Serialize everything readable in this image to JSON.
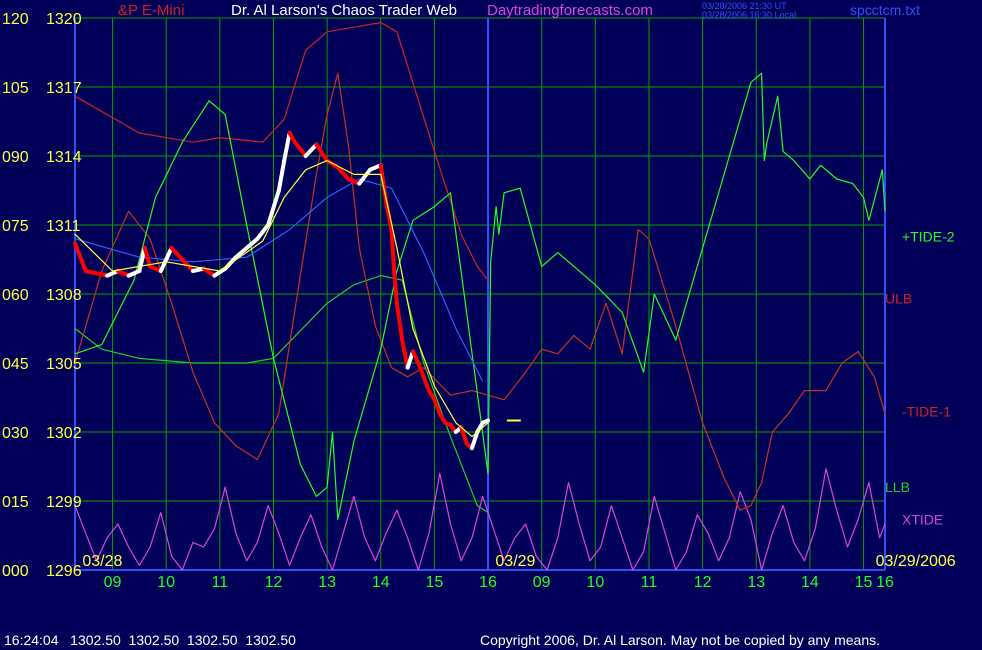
{
  "header": {
    "symbol": "&P E-Mini",
    "title": "Dr. Al Larson's Chaos Trader Web",
    "site": "Daytradingforecasts.com",
    "utc_line": "03/28/2006 21:30 UT",
    "local_line": "03/28/2006 16:30 Local",
    "file": "spcctcm.txt"
  },
  "footer": {
    "quote": "16:24:04   1302.50  1302.50  1302.50  1302.50",
    "copyright": "Copyright 2006, Dr. Al Larson. May not be copied by any means."
  },
  "colors": {
    "background": "#000058",
    "grid": "#00a000",
    "axis": "#3050ff",
    "price_up": "#ffffff",
    "price_down": "#ff0000",
    "tide2": "#20ff20",
    "ulb": "#d02020",
    "llb": "#20d020",
    "tide1": "#c83020",
    "xtide": "#e040e0",
    "ma_fast": "#ffff40",
    "ma_slow": "#3060ff"
  },
  "chart_data": {
    "type": "line",
    "left_axis_labels": [
      "120",
      "105",
      "090",
      "075",
      "060",
      "045",
      "030",
      "015",
      "000"
    ],
    "price_axis_labels": [
      "1320",
      "1317",
      "1314",
      "1311",
      "1308",
      "1305",
      "1302",
      "1299",
      "1296"
    ],
    "price_range": [
      1296,
      1320
    ],
    "oscillator_range": [
      0,
      120
    ],
    "x_ticks": [
      "09",
      "10",
      "11",
      "12",
      "13",
      "14",
      "15",
      "16",
      "09",
      "10",
      "11",
      "12",
      "13",
      "14",
      "15",
      "16"
    ],
    "hours_range": [
      8.3,
      23.4
    ],
    "date_labels": [
      {
        "text": "03/28",
        "hour": 8.4
      },
      {
        "text": "03/29",
        "hour": 16.1
      },
      {
        "text": "03/29/2006",
        "hour": 23.3
      }
    ],
    "last_price": 1302.5,
    "series_labels": [
      {
        "name": "+TIDE-2",
        "key": "tide2"
      },
      {
        "name": "ULB",
        "key": "ulb"
      },
      {
        "name": "-TIDE-1",
        "key": "tide1"
      },
      {
        "name": "LLB",
        "key": "llb"
      },
      {
        "name": "XTIDE",
        "key": "xtide"
      }
    ],
    "price_series": [
      [
        8.3,
        1310.2
      ],
      [
        8.5,
        1309.0
      ],
      [
        8.7,
        1308.9
      ],
      [
        8.9,
        1308.8
      ],
      [
        9.1,
        1309.0
      ],
      [
        9.3,
        1308.8
      ],
      [
        9.5,
        1309.0
      ],
      [
        9.6,
        1310.0
      ],
      [
        9.7,
        1309.2
      ],
      [
        9.9,
        1309.0
      ],
      [
        10.1,
        1310.0
      ],
      [
        10.3,
        1309.5
      ],
      [
        10.5,
        1309.0
      ],
      [
        10.7,
        1309.1
      ],
      [
        10.9,
        1308.8
      ],
      [
        11.1,
        1309.1
      ],
      [
        11.3,
        1309.6
      ],
      [
        11.5,
        1310.0
      ],
      [
        11.7,
        1310.4
      ],
      [
        11.9,
        1311.0
      ],
      [
        12.1,
        1312.5
      ],
      [
        12.2,
        1313.8
      ],
      [
        12.3,
        1315.0
      ],
      [
        12.4,
        1314.6
      ],
      [
        12.6,
        1314.0
      ],
      [
        12.8,
        1314.5
      ],
      [
        13.0,
        1313.8
      ],
      [
        13.2,
        1313.5
      ],
      [
        13.4,
        1313.0
      ],
      [
        13.6,
        1312.8
      ],
      [
        13.8,
        1313.4
      ],
      [
        14.0,
        1313.6
      ],
      [
        14.1,
        1312.0
      ],
      [
        14.2,
        1310.8
      ],
      [
        14.25,
        1309.0
      ],
      [
        14.3,
        1307.6
      ],
      [
        14.4,
        1306.0
      ],
      [
        14.5,
        1304.8
      ],
      [
        14.6,
        1305.5
      ],
      [
        14.7,
        1305.0
      ],
      [
        14.8,
        1304.4
      ],
      [
        14.9,
        1303.8
      ],
      [
        15.0,
        1303.4
      ],
      [
        15.1,
        1302.8
      ],
      [
        15.2,
        1302.4
      ],
      [
        15.3,
        1302.3
      ],
      [
        15.4,
        1302.0
      ],
      [
        15.5,
        1302.2
      ],
      [
        15.6,
        1301.5
      ],
      [
        15.7,
        1301.3
      ],
      [
        15.8,
        1302.0
      ],
      [
        15.9,
        1302.4
      ],
      [
        16.0,
        1302.5
      ]
    ],
    "ma_fast": [
      [
        8.3,
        1310.6
      ],
      [
        9.0,
        1309.0
      ],
      [
        10.0,
        1309.4
      ],
      [
        11.0,
        1309.0
      ],
      [
        11.8,
        1310.3
      ],
      [
        12.2,
        1312.2
      ],
      [
        12.6,
        1313.4
      ],
      [
        13.0,
        1313.8
      ],
      [
        13.5,
        1313.2
      ],
      [
        14.0,
        1313.2
      ],
      [
        14.3,
        1310.0
      ],
      [
        14.6,
        1306.5
      ],
      [
        15.0,
        1304.0
      ],
      [
        15.4,
        1302.4
      ],
      [
        15.7,
        1301.8
      ],
      [
        16.0,
        1302.4
      ]
    ],
    "ma_slow": [
      [
        8.3,
        1310.4
      ],
      [
        9.5,
        1309.6
      ],
      [
        10.5,
        1309.4
      ],
      [
        11.5,
        1309.6
      ],
      [
        12.3,
        1310.8
      ],
      [
        13.0,
        1312.2
      ],
      [
        13.6,
        1313.0
      ],
      [
        14.2,
        1312.6
      ],
      [
        14.8,
        1309.8
      ],
      [
        15.4,
        1306.5
      ],
      [
        15.9,
        1304.2
      ]
    ],
    "ulb": [
      [
        8.3,
        1316.6
      ],
      [
        9.5,
        1315.0
      ],
      [
        10.5,
        1314.6
      ],
      [
        11.0,
        1314.8
      ],
      [
        11.8,
        1314.6
      ],
      [
        12.2,
        1315.6
      ],
      [
        12.6,
        1318.6
      ],
      [
        13.0,
        1319.4
      ],
      [
        13.5,
        1319.6
      ],
      [
        14.0,
        1319.8
      ],
      [
        14.3,
        1319.4
      ],
      [
        15.0,
        1314.2
      ],
      [
        15.5,
        1310.6
      ],
      [
        15.8,
        1309.2
      ],
      [
        16.0,
        1308.6
      ]
    ],
    "llb": [
      [
        8.3,
        1306.5
      ],
      [
        8.8,
        1305.6
      ],
      [
        9.5,
        1305.2
      ],
      [
        10.5,
        1305.0
      ],
      [
        11.5,
        1305.0
      ],
      [
        12.0,
        1305.2
      ],
      [
        12.5,
        1306.4
      ],
      [
        13.0,
        1307.6
      ],
      [
        13.5,
        1308.4
      ],
      [
        14.0,
        1308.8
      ],
      [
        14.4,
        1308.6
      ],
      [
        14.8,
        1305.0
      ],
      [
        15.3,
        1301.8
      ],
      [
        15.8,
        1298.8
      ],
      [
        16.0,
        1298.5
      ]
    ],
    "tide2": [
      [
        8.3,
        1305.4
      ],
      [
        8.8,
        1305.8
      ],
      [
        9.4,
        1308.6
      ],
      [
        9.8,
        1312.2
      ],
      [
        10.3,
        1314.6
      ],
      [
        10.8,
        1316.4
      ],
      [
        11.1,
        1315.8
      ],
      [
        11.5,
        1311.0
      ],
      [
        12.0,
        1305.2
      ],
      [
        12.5,
        1300.6
      ],
      [
        12.8,
        1299.2
      ],
      [
        13.0,
        1299.6
      ],
      [
        13.1,
        1302.0
      ],
      [
        13.2,
        1298.2
      ],
      [
        13.5,
        1301.6
      ],
      [
        14.0,
        1305.6
      ],
      [
        14.3,
        1309.0
      ],
      [
        14.6,
        1311.2
      ],
      [
        15.0,
        1311.8
      ],
      [
        15.3,
        1312.4
      ],
      [
        15.6,
        1307.2
      ],
      [
        16.0,
        1300.2
      ],
      [
        16.05,
        1309.4
      ],
      [
        16.1,
        1310.6
      ],
      [
        16.15,
        1311.8
      ],
      [
        16.2,
        1310.6
      ],
      [
        16.3,
        1312.4
      ],
      [
        16.6,
        1312.6
      ],
      [
        17.0,
        1309.2
      ],
      [
        17.3,
        1309.8
      ],
      [
        18.0,
        1308.4
      ],
      [
        18.5,
        1307.2
      ],
      [
        18.9,
        1304.6
      ],
      [
        19.1,
        1308.0
      ],
      [
        19.5,
        1306.0
      ],
      [
        20.0,
        1310.0
      ],
      [
        20.5,
        1314.0
      ],
      [
        20.9,
        1317.2
      ],
      [
        21.1,
        1317.6
      ],
      [
        21.15,
        1313.8
      ],
      [
        21.2,
        1314.6
      ],
      [
        21.4,
        1316.6
      ],
      [
        21.5,
        1314.2
      ],
      [
        21.7,
        1313.8
      ],
      [
        22.0,
        1313.0
      ],
      [
        22.2,
        1313.6
      ],
      [
        22.5,
        1313.0
      ],
      [
        22.8,
        1312.8
      ],
      [
        23.0,
        1312.2
      ],
      [
        23.1,
        1311.2
      ],
      [
        23.35,
        1313.4
      ],
      [
        23.4,
        1311.6
      ]
    ],
    "tide1": [
      [
        8.3,
        1305.0
      ],
      [
        8.8,
        1309.0
      ],
      [
        9.3,
        1311.6
      ],
      [
        9.7,
        1310.4
      ],
      [
        10.1,
        1307.6
      ],
      [
        10.5,
        1304.6
      ],
      [
        10.9,
        1302.4
      ],
      [
        11.3,
        1301.4
      ],
      [
        11.7,
        1300.8
      ],
      [
        12.1,
        1302.8
      ],
      [
        12.5,
        1308.8
      ],
      [
        12.8,
        1313.2
      ],
      [
        13.0,
        1315.8
      ],
      [
        13.2,
        1317.6
      ],
      [
        13.4,
        1314.4
      ],
      [
        13.6,
        1310.0
      ],
      [
        13.9,
        1306.6
      ],
      [
        14.2,
        1304.8
      ],
      [
        14.5,
        1304.4
      ],
      [
        14.8,
        1304.8
      ],
      [
        15.3,
        1303.6
      ],
      [
        15.7,
        1303.8
      ],
      [
        16.0,
        1303.6
      ],
      [
        16.3,
        1303.4
      ],
      [
        16.7,
        1304.6
      ],
      [
        17.0,
        1305.6
      ],
      [
        17.3,
        1305.4
      ],
      [
        17.6,
        1306.2
      ],
      [
        17.9,
        1305.6
      ],
      [
        18.2,
        1307.6
      ],
      [
        18.5,
        1305.4
      ],
      [
        18.8,
        1310.8
      ],
      [
        19.0,
        1310.4
      ],
      [
        19.5,
        1306.6
      ],
      [
        20.0,
        1302.4
      ],
      [
        20.4,
        1300.0
      ],
      [
        20.7,
        1298.6
      ],
      [
        20.9,
        1298.8
      ],
      [
        21.1,
        1299.8
      ],
      [
        21.3,
        1302.0
      ],
      [
        21.6,
        1302.8
      ],
      [
        21.9,
        1303.8
      ],
      [
        22.3,
        1303.8
      ],
      [
        22.6,
        1305.0
      ],
      [
        22.9,
        1305.5
      ],
      [
        23.2,
        1304.4
      ],
      [
        23.4,
        1302.8
      ]
    ],
    "xtide": [
      [
        8.3,
        1298.8
      ],
      [
        8.5,
        1297.6
      ],
      [
        8.7,
        1296.4
      ],
      [
        8.9,
        1297.4
      ],
      [
        9.1,
        1298.0
      ],
      [
        9.3,
        1297.0
      ],
      [
        9.5,
        1296.2
      ],
      [
        9.7,
        1297.0
      ],
      [
        9.9,
        1298.5
      ],
      [
        10.1,
        1296.6
      ],
      [
        10.3,
        1296.0
      ],
      [
        10.5,
        1297.2
      ],
      [
        10.7,
        1297.0
      ],
      [
        10.9,
        1297.8
      ],
      [
        11.1,
        1299.6
      ],
      [
        11.3,
        1297.6
      ],
      [
        11.5,
        1296.4
      ],
      [
        11.7,
        1297.2
      ],
      [
        11.9,
        1298.8
      ],
      [
        12.1,
        1297.6
      ],
      [
        12.3,
        1296.2
      ],
      [
        12.5,
        1297.4
      ],
      [
        12.7,
        1298.4
      ],
      [
        12.9,
        1297.0
      ],
      [
        13.1,
        1296.0
      ],
      [
        13.3,
        1297.6
      ],
      [
        13.5,
        1299.2
      ],
      [
        13.7,
        1297.4
      ],
      [
        13.9,
        1296.4
      ],
      [
        14.1,
        1297.6
      ],
      [
        14.3,
        1298.6
      ],
      [
        14.5,
        1297.4
      ],
      [
        14.7,
        1296.0
      ],
      [
        14.9,
        1297.6
      ],
      [
        15.1,
        1300.2
      ],
      [
        15.3,
        1298.0
      ],
      [
        15.5,
        1296.4
      ],
      [
        15.7,
        1297.4
      ],
      [
        15.9,
        1299.2
      ],
      [
        16.1,
        1297.8
      ],
      [
        16.3,
        1296.4
      ],
      [
        16.5,
        1297.4
      ],
      [
        16.7,
        1298.0
      ],
      [
        16.9,
        1296.6
      ],
      [
        17.1,
        1296.0
      ],
      [
        17.3,
        1297.4
      ],
      [
        17.5,
        1299.8
      ],
      [
        17.7,
        1298.0
      ],
      [
        17.9,
        1296.4
      ],
      [
        18.1,
        1297.0
      ],
      [
        18.3,
        1298.8
      ],
      [
        18.5,
        1297.4
      ],
      [
        18.7,
        1296.0
      ],
      [
        18.9,
        1296.8
      ],
      [
        19.1,
        1299.2
      ],
      [
        19.3,
        1297.6
      ],
      [
        19.5,
        1296.0
      ],
      [
        19.7,
        1296.8
      ],
      [
        19.9,
        1298.4
      ],
      [
        20.1,
        1297.6
      ],
      [
        20.3,
        1296.4
      ],
      [
        20.5,
        1297.4
      ],
      [
        20.7,
        1299.4
      ],
      [
        20.9,
        1298.2
      ],
      [
        21.1,
        1296.0
      ],
      [
        21.3,
        1297.6
      ],
      [
        21.5,
        1298.8
      ],
      [
        21.7,
        1297.2
      ],
      [
        21.9,
        1296.4
      ],
      [
        22.1,
        1297.8
      ],
      [
        22.3,
        1300.4
      ],
      [
        22.5,
        1298.6
      ],
      [
        22.7,
        1297.0
      ],
      [
        22.9,
        1298.2
      ],
      [
        23.1,
        1299.8
      ],
      [
        23.3,
        1297.4
      ],
      [
        23.4,
        1298.0
      ]
    ]
  }
}
